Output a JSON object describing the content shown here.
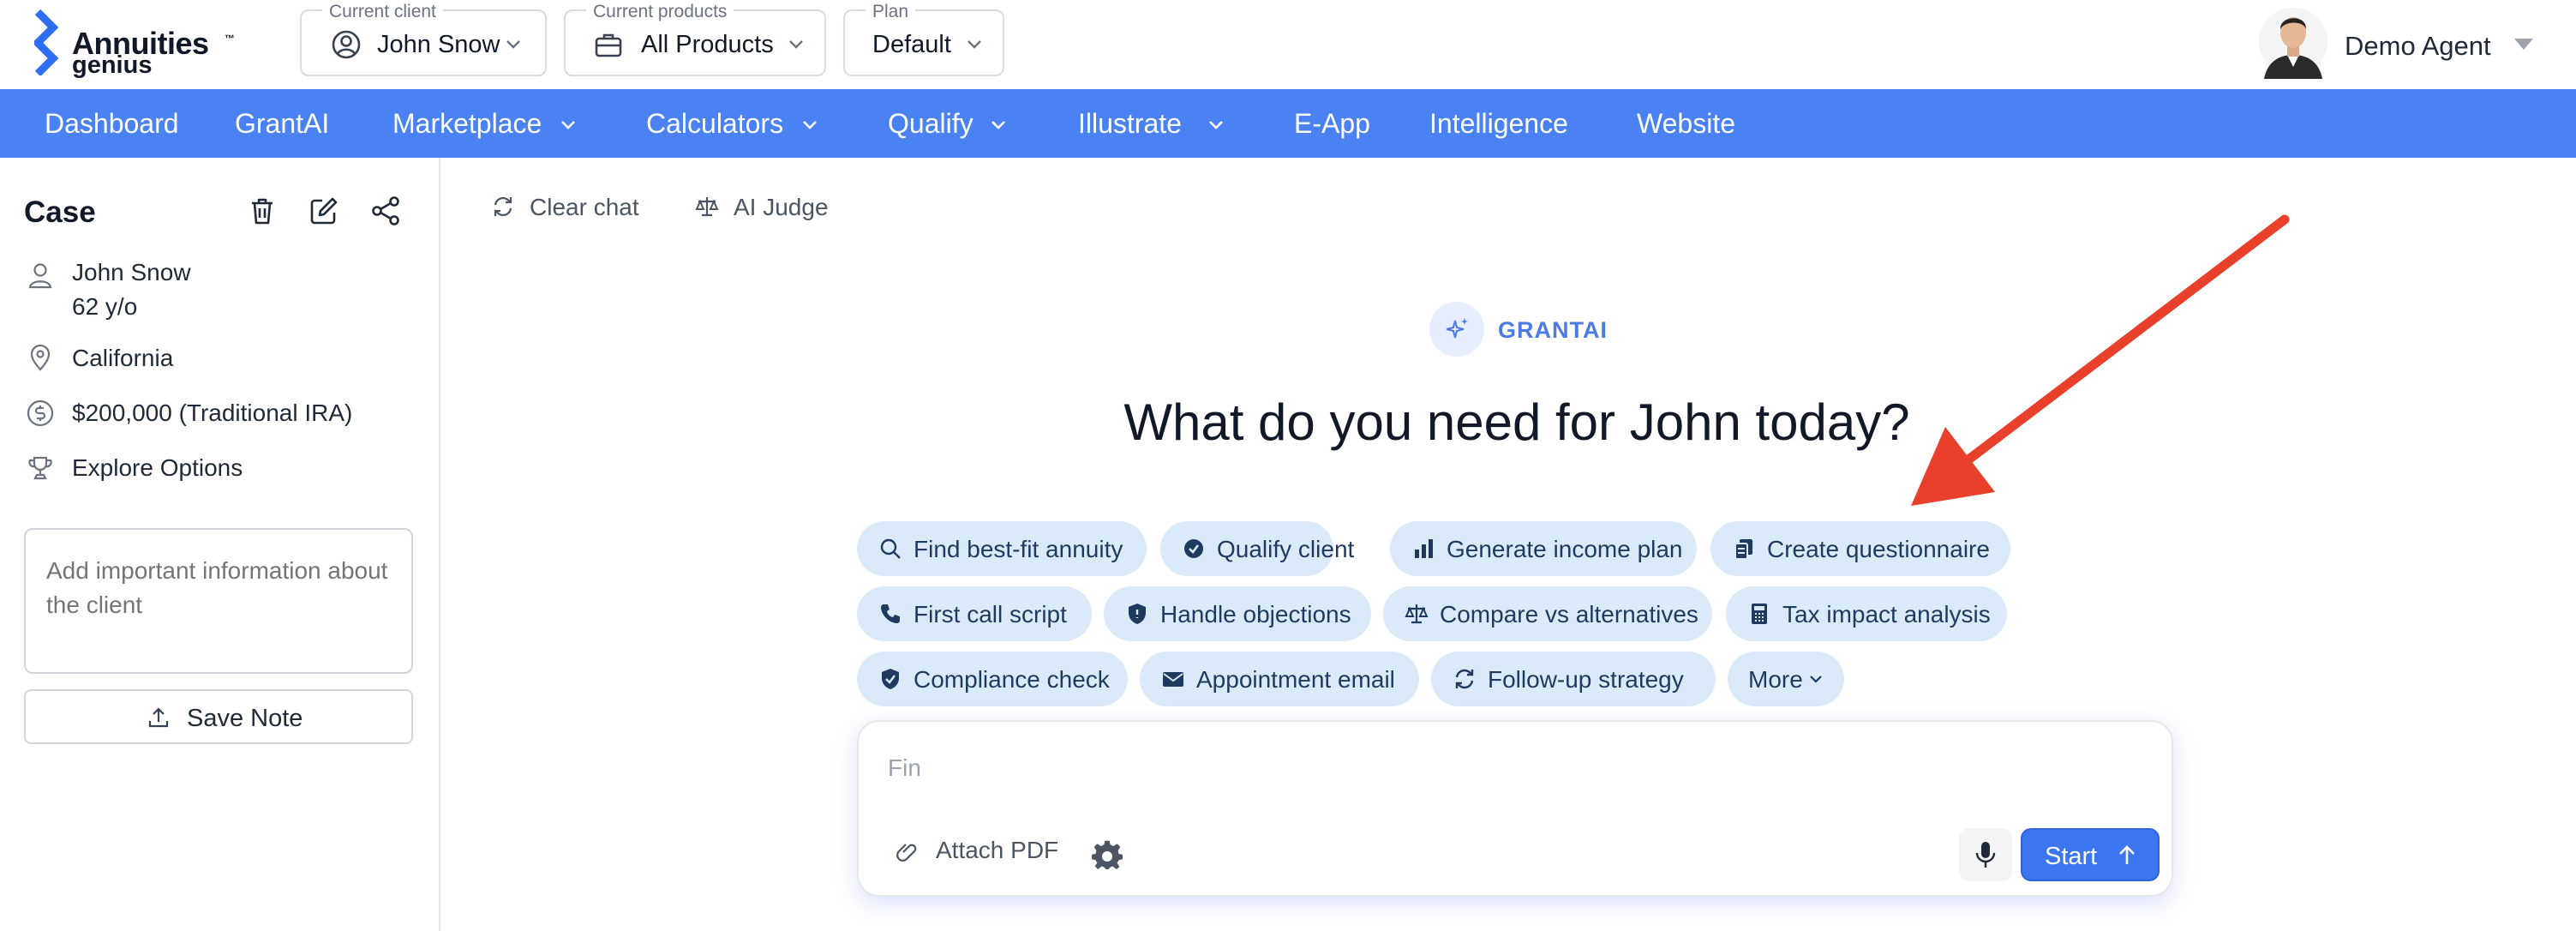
{
  "app": {
    "logo_line1": "Annuities",
    "logo_tm": "™",
    "logo_line2": "genius"
  },
  "header": {
    "client": {
      "caption": "Current client",
      "value": "John Snow"
    },
    "products": {
      "caption": "Current products",
      "value": "All Products"
    },
    "plan": {
      "caption": "Plan",
      "value": "Default"
    },
    "agent_name": "Demo Agent"
  },
  "nav": {
    "items": [
      {
        "label": "Dashboard",
        "dropdown": false
      },
      {
        "label": "GrantAI",
        "dropdown": false
      },
      {
        "label": "Marketplace",
        "dropdown": true
      },
      {
        "label": "Calculators",
        "dropdown": true
      },
      {
        "label": "Qualify",
        "dropdown": true
      },
      {
        "label": "Illustrate",
        "dropdown": true
      },
      {
        "label": "E-App",
        "dropdown": false
      },
      {
        "label": "Intelligence",
        "dropdown": false
      },
      {
        "label": "Website",
        "dropdown": false
      }
    ]
  },
  "sidebar": {
    "title": "Case",
    "client_name": "John Snow",
    "client_age": "62 y/o",
    "state": "California",
    "funds": "$200,000 (Traditional IRA)",
    "goal": "Explore Options",
    "note_placeholder": "Add important information about the client",
    "save_label": "Save Note"
  },
  "main": {
    "clear_chat": "Clear chat",
    "ai_judge": "AI Judge",
    "badge": "GRANTAI",
    "headline": "What do you need for John today?",
    "chips": [
      {
        "label": "Find best-fit annuity",
        "icon": "search-icon"
      },
      {
        "label": "Qualify client",
        "icon": "check-badge-icon"
      },
      {
        "label": "Generate income plan",
        "icon": "bar-chart-icon"
      },
      {
        "label": "Create questionnaire",
        "icon": "documents-icon"
      },
      {
        "label": "First call script",
        "icon": "phone-icon"
      },
      {
        "label": "Handle objections",
        "icon": "shield-icon"
      },
      {
        "label": "Compare vs alternatives",
        "icon": "scale-icon"
      },
      {
        "label": "Tax impact analysis",
        "icon": "calculator-icon"
      },
      {
        "label": "Compliance check",
        "icon": "shield-check-icon"
      },
      {
        "label": "Appointment email",
        "icon": "envelope-icon"
      },
      {
        "label": "Follow-up strategy",
        "icon": "refresh-icon"
      },
      {
        "label": "More",
        "icon": "chevron-down-icon"
      }
    ],
    "composer": {
      "input_value": "Fin",
      "attach_label": "Attach PDF",
      "start_label": "Start"
    }
  },
  "colors": {
    "nav": "#4b82f3",
    "chip": "#dbeaf9",
    "start": "#3b76f0",
    "arrow": "#e8402a"
  }
}
